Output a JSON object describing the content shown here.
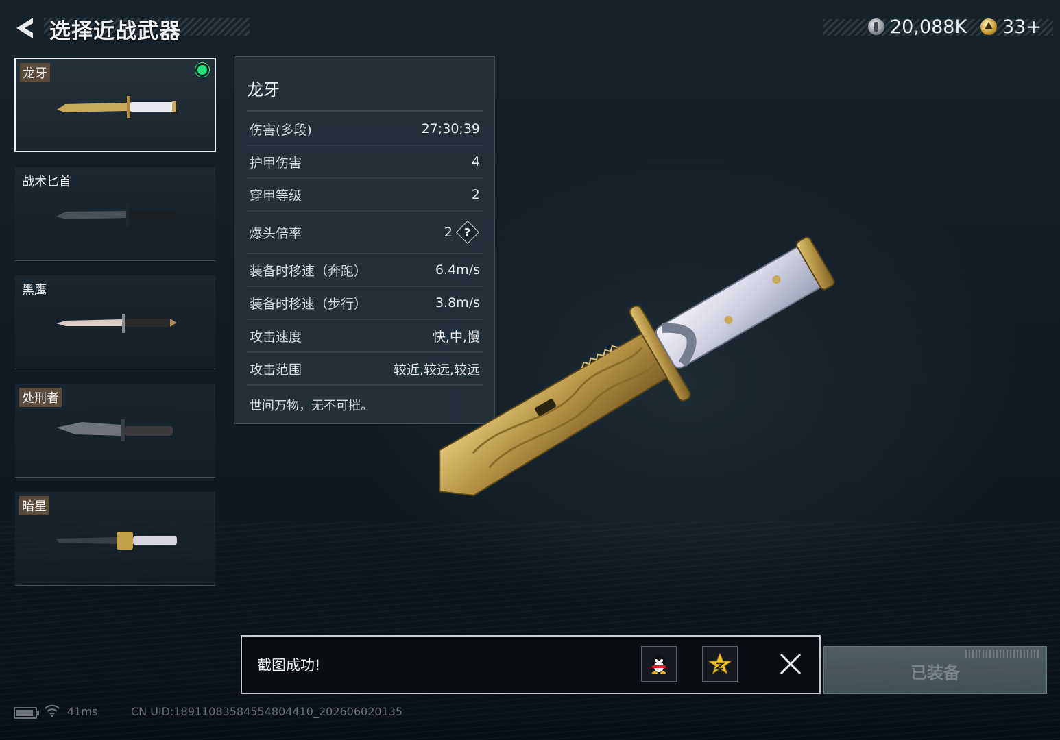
{
  "header": {
    "title": "选择近战武器",
    "currency_1": "20,088K",
    "currency_2": "33+"
  },
  "weapons": [
    {
      "name": "龙牙",
      "selected": true,
      "equipped": true,
      "tag_style": true
    },
    {
      "name": "战术匕首",
      "selected": false,
      "equipped": false,
      "tag_style": false
    },
    {
      "name": "黑鹰",
      "selected": false,
      "equipped": false,
      "tag_style": false
    },
    {
      "name": "处刑者",
      "selected": false,
      "equipped": false,
      "tag_style": true
    },
    {
      "name": "暗星",
      "selected": false,
      "equipped": false,
      "tag_style": true
    }
  ],
  "stats": {
    "name": "龙牙",
    "rows": [
      {
        "label": "伤害(多段)",
        "value": "27;30;39"
      },
      {
        "label": "护甲伤害",
        "value": "4"
      },
      {
        "label": "穿甲等级",
        "value": "2"
      },
      {
        "label": "爆头倍率",
        "value": "2"
      },
      {
        "label": "装备时移速（奔跑）",
        "value": "6.4m/s"
      },
      {
        "label": "装备时移速（步行）",
        "value": "3.8m/s"
      },
      {
        "label": "攻击速度",
        "value": "快,中,慢"
      },
      {
        "label": "攻击范围",
        "value": "较近,较远,较远"
      }
    ],
    "help_glyph": "?",
    "description": "世间万物，无不可摧。"
  },
  "toast": {
    "message": "截图成功!"
  },
  "equip_button": {
    "label": "已装备"
  },
  "status_bar": {
    "ping": "41ms",
    "uid": "CN UID:18911083584554804410_202606020135"
  },
  "colors": {
    "equipped_dot": "#25e07a",
    "panel_bg": "#26323c",
    "gold_blade": "#b89a4a"
  }
}
